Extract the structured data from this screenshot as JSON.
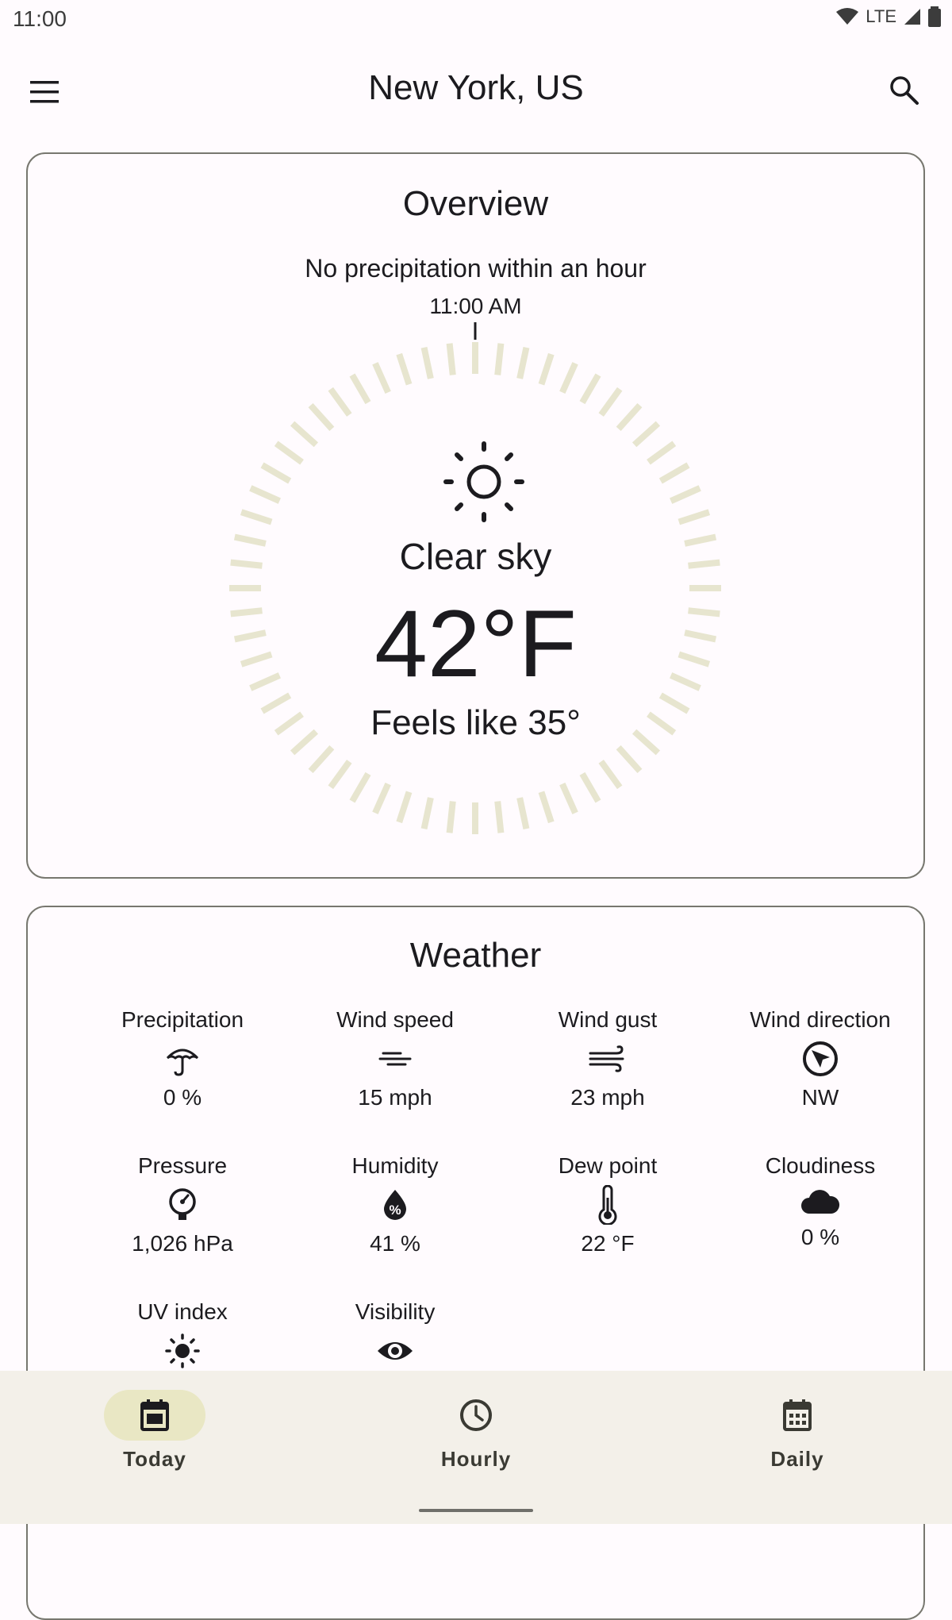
{
  "status_bar": {
    "time": "11:00",
    "network": "LTE"
  },
  "app_bar": {
    "title": "New York, US"
  },
  "overview": {
    "title": "Overview",
    "precipitation_text": "No precipitation within an hour",
    "time_label": "11:00 AM",
    "condition": "Clear sky",
    "temperature": "42°F",
    "feels_like": "Feels like 35°"
  },
  "weather": {
    "title": "Weather",
    "items": [
      {
        "label": "Precipitation",
        "icon": "umbrella-icon",
        "value": "0 %"
      },
      {
        "label": "Wind speed",
        "icon": "wind-icon",
        "value": "15 mph"
      },
      {
        "label": "Wind gust",
        "icon": "wind-gust-icon",
        "value": "23 mph"
      },
      {
        "label": "Wind direction",
        "icon": "compass-arrow-icon",
        "value": "NW"
      },
      {
        "label": "Pressure",
        "icon": "gauge-icon",
        "value": "1,026 hPa"
      },
      {
        "label": "Humidity",
        "icon": "humidity-drop-icon",
        "value": "41 %"
      },
      {
        "label": "Dew point",
        "icon": "thermometer-icon",
        "value": "22 °F"
      },
      {
        "label": "Cloudiness",
        "icon": "cloud-icon",
        "value": "0 %"
      },
      {
        "label": "UV index",
        "icon": "sun-icon",
        "value": ""
      },
      {
        "label": "Visibility",
        "icon": "eye-icon",
        "value": ""
      }
    ]
  },
  "nav": {
    "items": [
      {
        "label": "Today",
        "icon": "calendar-today-icon",
        "active": true
      },
      {
        "label": "Hourly",
        "icon": "clock-icon",
        "active": false
      },
      {
        "label": "Daily",
        "icon": "calendar-daily-icon",
        "active": false
      }
    ]
  },
  "colors": {
    "dial_tick": "#e7e5cf",
    "nav_active": "#e9e7c4",
    "nav_bg": "#f3f0e9",
    "card_border": "#77776f"
  }
}
